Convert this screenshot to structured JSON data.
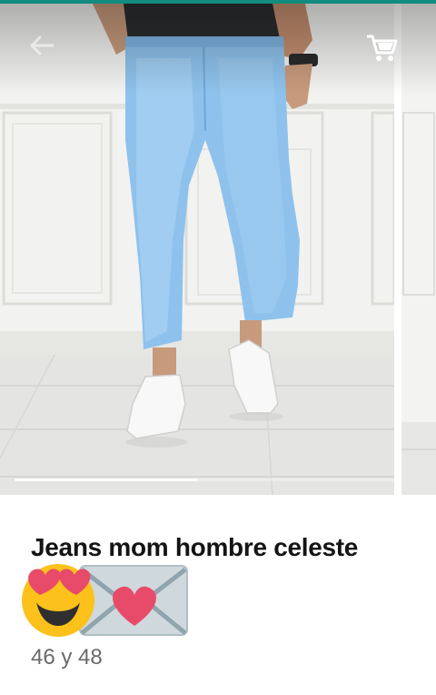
{
  "app": {
    "accent_color": "#128c7e"
  },
  "toolbar": {
    "back_icon": "arrow-left-icon",
    "cart_icon": "shopping-cart-icon"
  },
  "gallery": {
    "image_description_icon": "product-photo",
    "current_slide_fraction": 0.48
  },
  "product": {
    "title": "Jeans mom hombre celeste",
    "emojis": [
      "heart-eyes-face-icon",
      "love-letter-icon"
    ],
    "sizes": "46 y 48"
  }
}
